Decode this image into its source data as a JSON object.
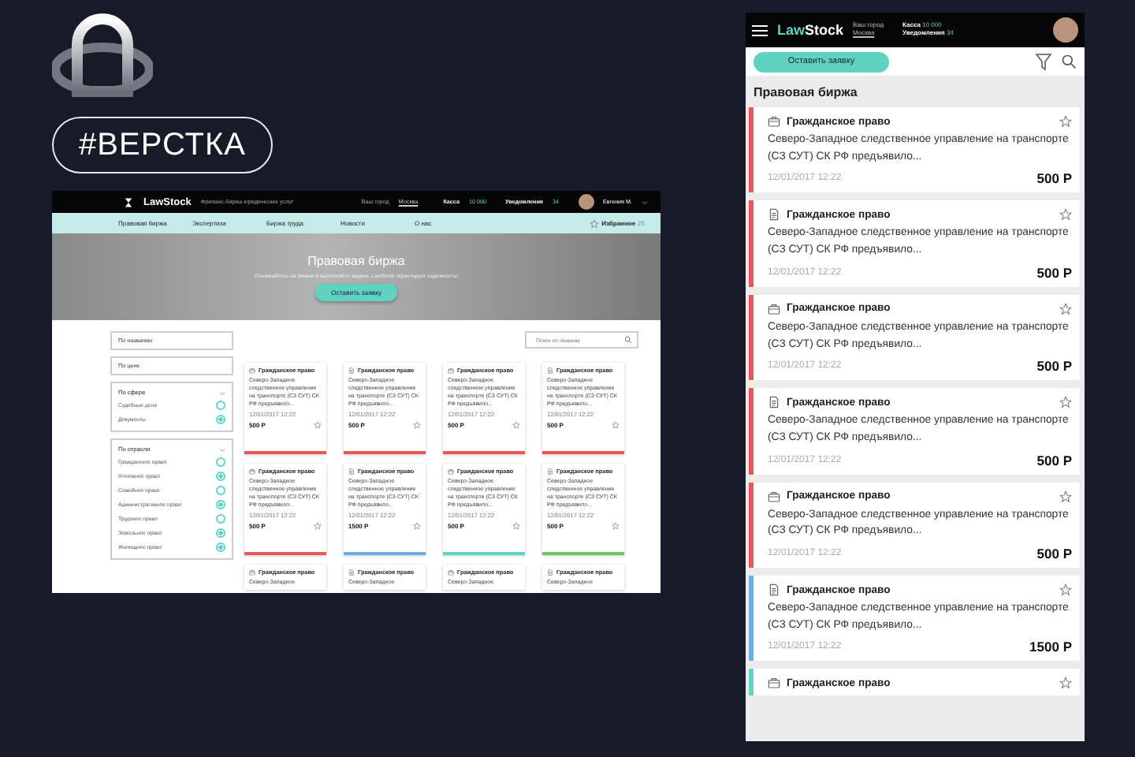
{
  "badge": "#ВЕРСТКА",
  "desktop": {
    "header": {
      "logo": "LawStock",
      "tagline": "Фриланс-биржа юридических услуг",
      "city_label": "Ваш город",
      "city": "Москва",
      "wallet_label": "Касса",
      "wallet": "10 000",
      "notifications_label": "Уведомления",
      "notifications": "34",
      "user": "Евгения М."
    },
    "nav": {
      "items": [
        {
          "label": "Правовая биржа",
          "selected": false
        },
        {
          "label": "Экспертиза",
          "selected": false
        },
        {
          "label": "Биржа труда",
          "selected": false
        },
        {
          "label": "Новости",
          "selected": false
        },
        {
          "label": "О нас",
          "selected": false
        }
      ],
      "favorites_label": "Избранное",
      "favorites_count": "25"
    },
    "hero": {
      "title": "Правовая биржа",
      "subtitle": "Откликайтесь на заявки и выполняйте задачи. LawStock гарантирует надежность!",
      "button": "Оставить заявку"
    },
    "sort_dropdowns": [
      "По названию",
      "По цене"
    ],
    "filter_groups": [
      {
        "title": "По сфере",
        "options": [
          {
            "label": "Судебные дела",
            "checked": false
          },
          {
            "label": "Документы",
            "checked": true
          }
        ]
      },
      {
        "title": "По отрасли",
        "options": [
          {
            "label": "Гражданское право",
            "checked": false
          },
          {
            "label": "Уголовное право",
            "checked": true
          },
          {
            "label": "Семейное право",
            "checked": false
          },
          {
            "label": "Административное право",
            "checked": true
          },
          {
            "label": "Трудовое право",
            "checked": false
          },
          {
            "label": "Земельное право",
            "checked": true
          },
          {
            "label": "Жилищное право",
            "checked": true
          }
        ]
      }
    ],
    "search": {
      "placeholder": "Поиск по заявкам"
    },
    "cards": [
      {
        "kind": "briefcase",
        "title": "Гражданское право",
        "text": "Северо-Западное следственное управление на транспорте (СЗ СУТ) СК РФ предъявило...",
        "date": "12/01/2017 12:22",
        "price": "500 Р",
        "color": "#e8575a"
      },
      {
        "kind": "document",
        "title": "Гражданское право",
        "text": "Северо-Западное следственное управление на транспорте (СЗ СУТ) СК РФ предъявило...",
        "date": "12/01/2017 12:22",
        "price": "500 Р",
        "color": "#e8575a"
      },
      {
        "kind": "briefcase",
        "title": "Гражданское право",
        "text": "Северо-Западное следственное управление на транспорте (СЗ СУТ) СК РФ предъявило...",
        "date": "12/01/2017 12:22",
        "price": "500 Р",
        "color": "#e8575a"
      },
      {
        "kind": "document",
        "title": "Гражданское право",
        "text": "Северо-Западное следственное управление на транспорте (СЗ СУТ) СК РФ предъявило...",
        "date": "12/01/2017 12:22",
        "price": "500 Р",
        "color": "#e8575a"
      },
      {
        "kind": "briefcase",
        "title": "Гражданское право",
        "text": "Северо-Западное следственное управление на транспорте (СЗ СУТ) СК РФ предъявило...",
        "date": "12/01/2017 12:22",
        "price": "500 Р",
        "color": "#e8575a"
      },
      {
        "kind": "document",
        "title": "Гражданское право",
        "text": "Северо-Западное следственное управление на транспорте (СЗ СУТ) СК РФ предъявило...",
        "date": "12/01/2017 12:22",
        "price": "1500 Р",
        "color": "#6aaee8"
      },
      {
        "kind": "briefcase",
        "title": "Гражданское право",
        "text": "Северо-Западное следственное управление на транспорте (СЗ СУТ) СК РФ предъявило...",
        "date": "12/01/2017 12:22",
        "price": "500 Р",
        "color": "#5fd3c6"
      },
      {
        "kind": "document",
        "title": "Гражданское право",
        "text": "Северо-Западное следственное управление на транспорте (СЗ СУТ) СК РФ предъявило...",
        "date": "12/01/2017 12:22",
        "price": "500 Р",
        "color": "#6cc95a"
      },
      {
        "kind": "briefcase",
        "title": "Гражданское право",
        "text": "Северо-Западное"
      },
      {
        "kind": "document",
        "title": "Гражданское право",
        "text": "Северо-Западное"
      },
      {
        "kind": "briefcase",
        "title": "Гражданское право",
        "text": "Северо-Западное"
      },
      {
        "kind": "document",
        "title": "Гражданское право",
        "text": "Северо-Западное"
      }
    ]
  },
  "mobile": {
    "header": {
      "logo_first": "Law",
      "logo_second": "Stock",
      "city_label": "Ваш город",
      "city": "Москва",
      "wallet_label": "Касса",
      "wallet": "10 000",
      "notifications_label": "Уведомления",
      "notifications": "34"
    },
    "button": "Оставить заявку",
    "heading": "Правовая биржа",
    "cards": [
      {
        "kind": "briefcase",
        "title": "Гражданское право",
        "text": "Северо-Западное следственное управление на транспорте (СЗ СУТ) СК РФ предъявило...",
        "date": "12/01/2017 12:22",
        "price": "500 Р",
        "color": "#e8575a"
      },
      {
        "kind": "document",
        "title": "Гражданское право",
        "text": "Северо-Западное следственное управление на транспорте (СЗ СУТ) СК РФ предъявило...",
        "date": "12/01/2017 12:22",
        "price": "500 Р",
        "color": "#e8575a"
      },
      {
        "kind": "briefcase",
        "title": "Гражданское право",
        "text": "Северо-Западное следственное управление на транспорте (СЗ СУТ) СК РФ предъявило...",
        "date": "12/01/2017 12:22",
        "price": "500 Р",
        "color": "#e8575a"
      },
      {
        "kind": "document",
        "title": "Гражданское право",
        "text": "Северо-Западное следственное управление на транспорте (СЗ СУТ) СК РФ предъявило...",
        "date": "12/01/2017 12:22",
        "price": "500 Р",
        "color": "#e8575a"
      },
      {
        "kind": "briefcase",
        "title": "Гражданское право",
        "text": "Северо-Западное следственное управление на транспорте (СЗ СУТ) СК РФ предъявило...",
        "date": "12/01/2017 12:22",
        "price": "500 Р",
        "color": "#e8575a"
      },
      {
        "kind": "document",
        "title": "Гражданское право",
        "text": "Северо-Западное следственное управление на транспорте (СЗ СУТ) СК РФ предъявило...",
        "date": "12/01/2017 12:22",
        "price": "1500 Р",
        "color": "#6aaee8"
      },
      {
        "kind": "briefcase",
        "title": "Гражданское право",
        "color": "#5fd3c6"
      }
    ]
  }
}
